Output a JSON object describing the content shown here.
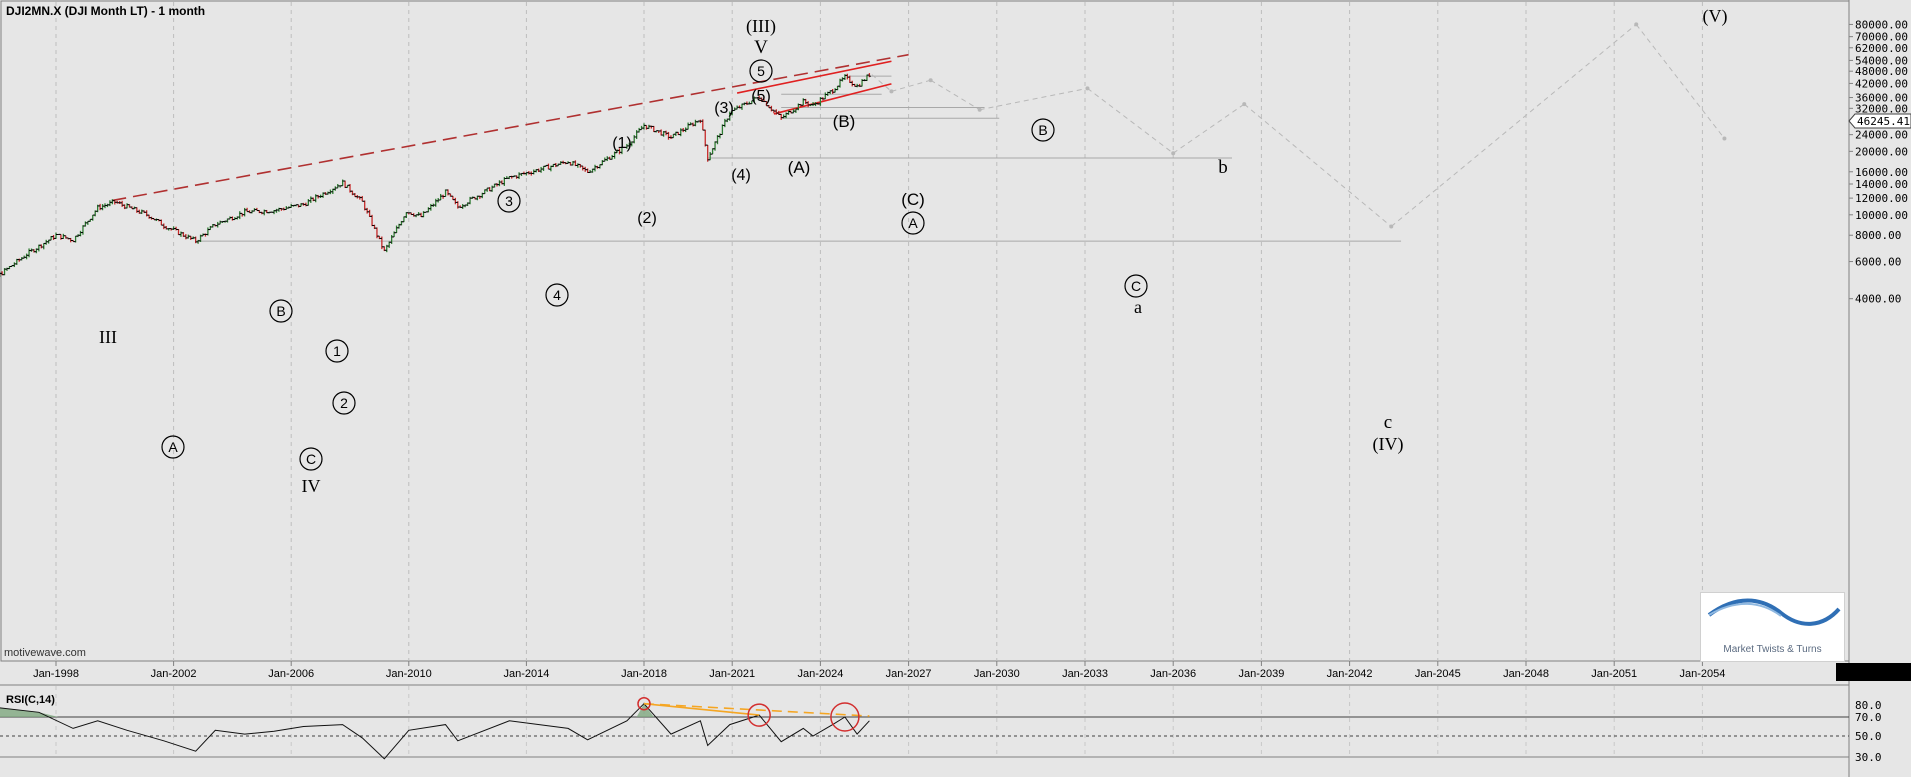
{
  "header": {
    "title": "DJI2MN.X (DJI Month LT) - 1 month",
    "watermark": "motivewave.com"
  },
  "logo": {
    "text": "Market Twists & Turns"
  },
  "price_labels": [
    "80000.00",
    "70000.00",
    "62000.00",
    "54000.00",
    "48000.00",
    "42000.00",
    "36000.00",
    "32000.00",
    "28000.00",
    "24000.00",
    "20000.00",
    "16000.00",
    "14000.00",
    "12000.00",
    "10000.00",
    "8000.00",
    "6000.00",
    "4000.00"
  ],
  "current_price": "46245.41",
  "time_labels": [
    "Jan-1998",
    "Jan-2002",
    "Jan-2006",
    "Jan-2010",
    "Jan-2014",
    "Jan-2018",
    "Jan-2021",
    "Jan-2024",
    "Jan-2027",
    "Jan-2030",
    "Jan-2033",
    "Jan-2036",
    "Jan-2039",
    "Jan-2042",
    "Jan-2045",
    "Jan-2048",
    "Jan-2051",
    "Jan-2054"
  ],
  "rsi": {
    "label": "RSI(C,14)",
    "levels": [
      "80.0",
      "70.0",
      "50.0",
      "30.0"
    ]
  },
  "wave_labels": {
    "iii_top": "III",
    "a_2002": "A",
    "b_2007": "B",
    "c_2009": "C",
    "iv_2009": "IV",
    "one_2011": "1",
    "two_2011": "2",
    "three_2018": "3",
    "four_2020": "4",
    "p1_2021": "(1)",
    "p2_2022": "(2)",
    "p3_2024": "(3)",
    "p4_2025": "(4)",
    "p5_2025": "(5)",
    "five_top": "5",
    "v_top": "V",
    "iii_paren_top": "(III)",
    "a_paren_2026": "(A)",
    "b_paren_2027": "(B)",
    "c_paren_2029": "(C)",
    "a_circ_2029": "A",
    "b_circ_2033": "B",
    "c_circ_2036": "C",
    "a_lower_2036": "a",
    "b_lower_2038": "b",
    "c_lower_2043": "c",
    "iv_paren_2043": "(IV)",
    "v_paren_2052": "(V)"
  },
  "chart_data": {
    "type": "line",
    "title": "DJI2MN.X (DJI Month LT) - 1 month",
    "xlabel": "",
    "ylabel": "",
    "yscale": "log",
    "ylim": [
      3000,
      95000
    ],
    "xlim": [
      "1994-06",
      "2055-06"
    ],
    "price_series": [
      {
        "x": "1995-01",
        "y": 3900
      },
      {
        "x": "1996-01",
        "y": 5100
      },
      {
        "x": "1997-01",
        "y": 6500
      },
      {
        "x": "1998-01",
        "y": 8000
      },
      {
        "x": "1998-08",
        "y": 7600
      },
      {
        "x": "1999-06",
        "y": 10800
      },
      {
        "x": "2000-01",
        "y": 11500
      },
      {
        "x": "2001-03",
        "y": 9900
      },
      {
        "x": "2001-09",
        "y": 8900
      },
      {
        "x": "2002-10",
        "y": 7500
      },
      {
        "x": "2003-06",
        "y": 9000
      },
      {
        "x": "2004-06",
        "y": 10300
      },
      {
        "x": "2005-06",
        "y": 10500
      },
      {
        "x": "2006-06",
        "y": 11200
      },
      {
        "x": "2007-10",
        "y": 14200
      },
      {
        "x": "2008-06",
        "y": 11500
      },
      {
        "x": "2009-03",
        "y": 6700
      },
      {
        "x": "2009-12",
        "y": 10400
      },
      {
        "x": "2010-06",
        "y": 9800
      },
      {
        "x": "2011-04",
        "y": 12800
      },
      {
        "x": "2011-09",
        "y": 10900
      },
      {
        "x": "2013-06",
        "y": 15000
      },
      {
        "x": "2015-06",
        "y": 17900
      },
      {
        "x": "2016-02",
        "y": 16000
      },
      {
        "x": "2017-06",
        "y": 21300
      },
      {
        "x": "2018-01",
        "y": 26600
      },
      {
        "x": "2018-12",
        "y": 23300
      },
      {
        "x": "2019-12",
        "y": 28500
      },
      {
        "x": "2020-03",
        "y": 18600
      },
      {
        "x": "2020-12",
        "y": 30600
      },
      {
        "x": "2021-12",
        "y": 36300
      },
      {
        "x": "2022-09",
        "y": 28700
      },
      {
        "x": "2023-06",
        "y": 34400
      },
      {
        "x": "2023-10",
        "y": 33000
      },
      {
        "x": "2024-06",
        "y": 39100
      },
      {
        "x": "2024-11",
        "y": 44900
      },
      {
        "x": "2025-04",
        "y": 40700
      },
      {
        "x": "2025-09",
        "y": 46245
      }
    ],
    "projection": [
      {
        "x": "2025-10",
        "y": 46245
      },
      {
        "x": "2026-06",
        "y": 38500
      },
      {
        "x": "2027-10",
        "y": 43500
      },
      {
        "x": "2029-06",
        "y": 31500
      },
      {
        "x": "2033-02",
        "y": 39800
      },
      {
        "x": "2036-01",
        "y": 19600
      },
      {
        "x": "2038-06",
        "y": 33500
      },
      {
        "x": "2043-06",
        "y": 8800
      },
      {
        "x": "2051-10",
        "y": 80000
      },
      {
        "x": "2054-10",
        "y": 23000
      }
    ],
    "horizontal_levels": [
      {
        "y": 7500,
        "from": "2002-10",
        "to": "2043-10"
      },
      {
        "y": 18600,
        "from": "2020-03",
        "to": "2038-01"
      },
      {
        "y": 28700,
        "from": "2022-09",
        "to": "2030-02"
      },
      {
        "y": 32300,
        "from": "2022-09",
        "to": "2029-08"
      },
      {
        "y": 37300,
        "from": "2022-09",
        "to": "2026-02"
      },
      {
        "y": 45500,
        "from": "2025-01",
        "to": "2026-06"
      }
    ],
    "rsi_series": [
      {
        "x": "1995-01",
        "y": 72
      },
      {
        "x": "1996-01",
        "y": 80
      },
      {
        "x": "1997-06",
        "y": 75
      },
      {
        "x": "1998-08",
        "y": 58
      },
      {
        "x": "1999-06",
        "y": 66
      },
      {
        "x": "2000-06",
        "y": 56
      },
      {
        "x": "2001-09",
        "y": 45
      },
      {
        "x": "2002-10",
        "y": 34
      },
      {
        "x": "2003-06",
        "y": 56
      },
      {
        "x": "2004-06",
        "y": 52
      },
      {
        "x": "2005-06",
        "y": 55
      },
      {
        "x": "2006-06",
        "y": 60
      },
      {
        "x": "2007-10",
        "y": 62
      },
      {
        "x": "2008-06",
        "y": 48
      },
      {
        "x": "2009-03",
        "y": 26
      },
      {
        "x": "2010-01",
        "y": 56
      },
      {
        "x": "2011-04",
        "y": 62
      },
      {
        "x": "2011-09",
        "y": 45
      },
      {
        "x": "2013-06",
        "y": 66
      },
      {
        "x": "2015-06",
        "y": 58
      },
      {
        "x": "2016-02",
        "y": 46
      },
      {
        "x": "2017-06",
        "y": 66
      },
      {
        "x": "2018-01",
        "y": 84
      },
      {
        "x": "2018-12",
        "y": 52
      },
      {
        "x": "2019-12",
        "y": 66
      },
      {
        "x": "2020-03",
        "y": 40
      },
      {
        "x": "2020-12",
        "y": 62
      },
      {
        "x": "2021-12",
        "y": 72
      },
      {
        "x": "2022-09",
        "y": 44
      },
      {
        "x": "2023-06",
        "y": 58
      },
      {
        "x": "2023-10",
        "y": 50
      },
      {
        "x": "2024-06",
        "y": 62
      },
      {
        "x": "2024-11",
        "y": 70
      },
      {
        "x": "2025-04",
        "y": 52
      },
      {
        "x": "2025-09",
        "y": 66
      }
    ],
    "colors": {
      "up_bar": "#2e7d32",
      "down_bar": "#c62828",
      "trendline": "#b03030",
      "channel": "#e02020",
      "rsi_trend": "#f5a623",
      "projection": "#b8b8b8",
      "background": "#e6e6e6",
      "price_tag": "#ffffff"
    },
    "grid": true
  }
}
